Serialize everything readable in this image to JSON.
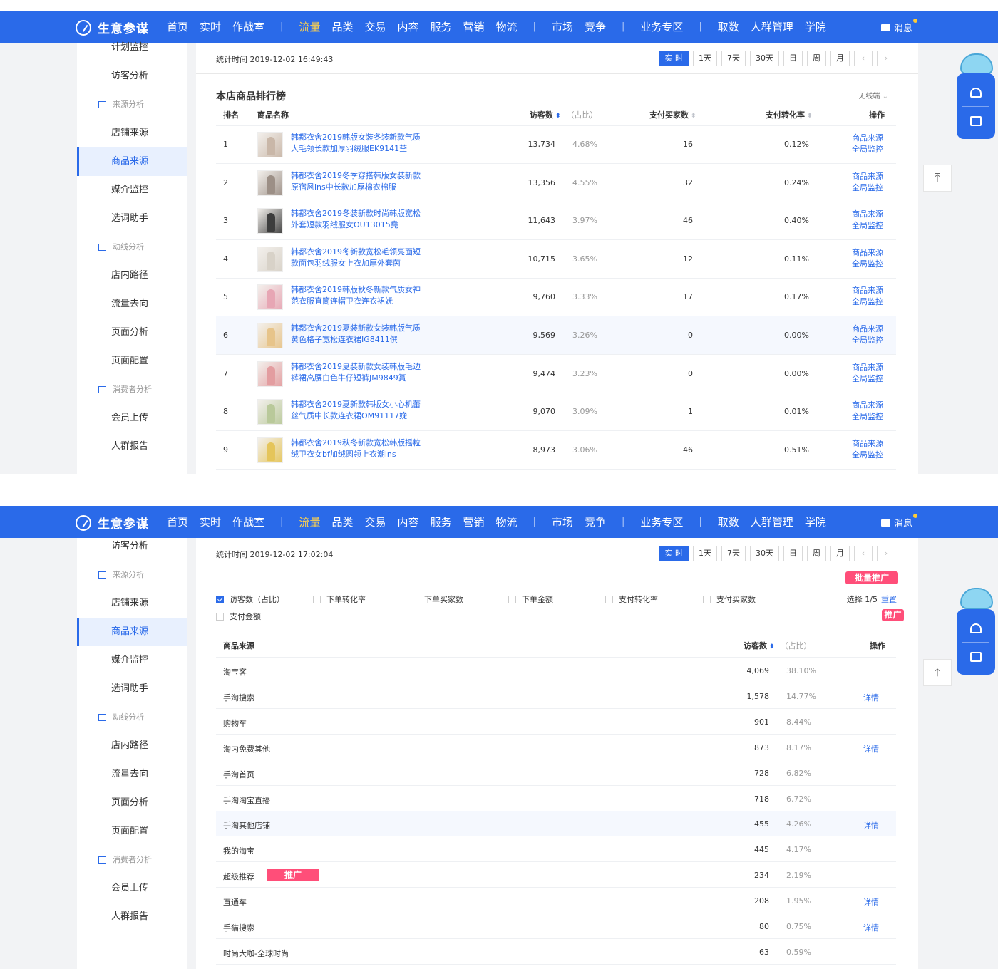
{
  "topbar": {
    "logo": "生意参谋",
    "nav": [
      "首页",
      "实时",
      "作战室",
      "|",
      "流量",
      "品类",
      "交易",
      "内容",
      "服务",
      "营销",
      "物流",
      "|",
      "市场",
      "竞争",
      "|",
      "业务专区",
      "|",
      "取数",
      "人群管理",
      "学院"
    ],
    "active": "流量",
    "message": "消息"
  },
  "panel1": {
    "sidebar": [
      {
        "label": "计划监控",
        "type": "item"
      },
      {
        "label": "访客分析",
        "type": "item"
      },
      {
        "label": "来源分析",
        "type": "group"
      },
      {
        "label": "店铺来源",
        "type": "item"
      },
      {
        "label": "商品来源",
        "type": "item",
        "active": true
      },
      {
        "label": "媒介监控",
        "type": "item"
      },
      {
        "label": "选词助手",
        "type": "item"
      },
      {
        "label": "动线分析",
        "type": "group"
      },
      {
        "label": "店内路径",
        "type": "item"
      },
      {
        "label": "流量去向",
        "type": "item"
      },
      {
        "label": "页面分析",
        "type": "item"
      },
      {
        "label": "页面配置",
        "type": "item"
      },
      {
        "label": "消费者分析",
        "type": "group"
      },
      {
        "label": "会员上传",
        "type": "item"
      },
      {
        "label": "人群报告",
        "type": "item"
      }
    ],
    "stat_time": "统计时间 2019-12-02 16:49:43",
    "time_buttons": [
      "实 时",
      "1天",
      "7天",
      "30天",
      "日",
      "周",
      "月"
    ],
    "title": "本店商品排行榜",
    "device": "无线端",
    "headers": {
      "rank": "排名",
      "name": "商品名称",
      "visitors": "访客数",
      "share": "（占比）",
      "buyers": "支付买家数",
      "conversion": "支付转化率",
      "ops": "操作"
    },
    "ops_labels": [
      "商品来源",
      "全局监控"
    ],
    "rows": [
      {
        "rank": "1",
        "name1": "韩都衣舍2019韩版女装冬装新款气质",
        "name2": "大毛领长款加厚羽绒服EK9141荃",
        "visitors": "13,734",
        "share": "4.68%",
        "buyers": "16",
        "conversion": "0.12%",
        "img": "#c9b7a8"
      },
      {
        "rank": "2",
        "name1": "韩都衣舍2019冬季穿搭韩版女装新款",
        "name2": "原宿风ins中长款加厚棉衣棉服",
        "visitors": "13,356",
        "share": "4.55%",
        "buyers": "32",
        "conversion": "0.24%",
        "img": "#9c8f86"
      },
      {
        "rank": "3",
        "name1": "韩都衣舍2019冬装新款时尚韩版宽松",
        "name2": "外套短款羽绒服女OU13015堯",
        "visitors": "11,643",
        "share": "3.97%",
        "buyers": "46",
        "conversion": "0.40%",
        "img": "#3d3d3d"
      },
      {
        "rank": "4",
        "name1": "韩都衣舍2019冬新款宽松毛领亮面短",
        "name2": "款面包羽绒服女上衣加厚外套茵",
        "visitors": "10,715",
        "share": "3.65%",
        "buyers": "12",
        "conversion": "0.11%",
        "img": "#d8d2c8"
      },
      {
        "rank": "5",
        "name1": "韩都衣舍2019韩版秋冬新款气质女神",
        "name2": "范衣服直筒连帽卫衣连衣裙妩",
        "visitors": "9,760",
        "share": "3.33%",
        "buyers": "17",
        "conversion": "0.17%",
        "img": "#e7a6b4"
      },
      {
        "rank": "6",
        "name1": "韩都衣舍2019夏装新款女装韩版气质",
        "name2": "黄色格子宽松连衣裙IG8411僎",
        "visitors": "9,569",
        "share": "3.26%",
        "buyers": "0",
        "conversion": "0.00%",
        "img": "#e7c48a"
      },
      {
        "rank": "7",
        "name1": "韩都衣舍2019夏装新款女装韩版毛边",
        "name2": "裤裙高腰白色牛仔短裤JM9849篔",
        "visitors": "9,474",
        "share": "3.23%",
        "buyers": "0",
        "conversion": "0.00%",
        "img": "#e39da0"
      },
      {
        "rank": "8",
        "name1": "韩都衣舍2019夏新款韩版女小心机蕾",
        "name2": "丝气质中长款连衣裙OM91117娩",
        "visitors": "9,070",
        "share": "3.09%",
        "buyers": "1",
        "conversion": "0.01%",
        "img": "#b9c99a"
      },
      {
        "rank": "9",
        "name1": "韩都衣舍2019秋冬新款宽松韩版摇粒",
        "name2": "绒卫衣女bf加绒圆领上衣潮ins",
        "visitors": "8,973",
        "share": "3.06%",
        "buyers": "46",
        "conversion": "0.51%",
        "img": "#e5c55a"
      }
    ]
  },
  "panel2": {
    "sidebar": [
      {
        "label": "访客分析",
        "type": "item"
      },
      {
        "label": "来源分析",
        "type": "group"
      },
      {
        "label": "店铺来源",
        "type": "item"
      },
      {
        "label": "商品来源",
        "type": "item",
        "active": true
      },
      {
        "label": "媒介监控",
        "type": "item"
      },
      {
        "label": "选词助手",
        "type": "item"
      },
      {
        "label": "动线分析",
        "type": "group"
      },
      {
        "label": "店内路径",
        "type": "item"
      },
      {
        "label": "流量去向",
        "type": "item"
      },
      {
        "label": "页面分析",
        "type": "item"
      },
      {
        "label": "页面配置",
        "type": "item"
      },
      {
        "label": "消费者分析",
        "type": "group"
      },
      {
        "label": "会员上传",
        "type": "item"
      },
      {
        "label": "人群报告",
        "type": "item"
      }
    ],
    "stat_time": "统计时间 2019-12-02 17:02:04",
    "time_buttons": [
      "实 时",
      "1天",
      "7天",
      "30天",
      "日",
      "周",
      "月"
    ],
    "batch_promo": "批量推广",
    "promo": "推广",
    "checkboxes": [
      {
        "label": "访客数（占比）",
        "checked": true
      },
      {
        "label": "下单转化率",
        "checked": false
      },
      {
        "label": "下单买家数",
        "checked": false
      },
      {
        "label": "下单金额",
        "checked": false
      },
      {
        "label": "支付转化率",
        "checked": false
      },
      {
        "label": "支付买家数",
        "checked": false
      },
      {
        "label": "支付金额",
        "checked": false
      }
    ],
    "select_count": "选择 1/5",
    "reset": "重置",
    "headers": {
      "source": "商品来源",
      "visitors": "访客数",
      "share": "（占比）",
      "ops": "操作"
    },
    "detail_label": "详情",
    "rows": [
      {
        "source": "淘宝客",
        "visitors": "4,069",
        "share": "38.10%",
        "detail": false
      },
      {
        "source": "手淘搜索",
        "visitors": "1,578",
        "share": "14.77%",
        "detail": true
      },
      {
        "source": "购物车",
        "visitors": "901",
        "share": "8.44%",
        "detail": false
      },
      {
        "source": "淘内免费其他",
        "visitors": "873",
        "share": "8.17%",
        "detail": true
      },
      {
        "source": "手淘首页",
        "visitors": "728",
        "share": "6.82%",
        "detail": false
      },
      {
        "source": "手淘淘宝直播",
        "visitors": "718",
        "share": "6.72%",
        "detail": false
      },
      {
        "source": "手淘其他店铺",
        "visitors": "455",
        "share": "4.26%",
        "detail": true
      },
      {
        "source": "我的淘宝",
        "visitors": "445",
        "share": "4.17%",
        "detail": false
      },
      {
        "source": "超级推荐",
        "visitors": "234",
        "share": "2.19%",
        "detail": false,
        "promo": true
      },
      {
        "source": "直通车",
        "visitors": "208",
        "share": "1.95%",
        "detail": true
      },
      {
        "source": "手猫搜索",
        "visitors": "80",
        "share": "0.75%",
        "detail": true
      },
      {
        "source": "时尚大咖-全球时尚",
        "visitors": "63",
        "share": "0.59%",
        "detail": false
      }
    ]
  },
  "icons": {
    "logo": "compass-icon",
    "message": "mail-icon",
    "group": "building-icon",
    "bell": "bell-icon",
    "chat": "chat-icon",
    "top": "back-to-top-icon"
  },
  "colors": {
    "brand": "#2a6ae9",
    "nav_active": "#ffd24d",
    "promo": "#ff4e79"
  }
}
